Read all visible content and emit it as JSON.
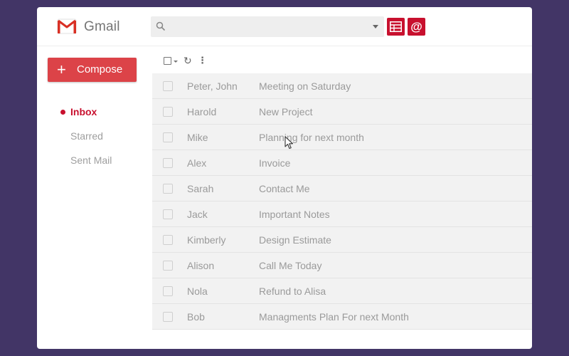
{
  "app": {
    "name": "Gmail"
  },
  "search": {
    "placeholder": "",
    "value": ""
  },
  "toolbar": {
    "sheet_icon": "spreadsheet-icon",
    "at_label": "@"
  },
  "sidebar": {
    "compose_label": "Compose",
    "items": [
      {
        "label": "Inbox",
        "active": true
      },
      {
        "label": "Starred",
        "active": false
      },
      {
        "label": "Sent Mail",
        "active": false
      }
    ]
  },
  "emails": [
    {
      "sender": "Peter, John",
      "subject": "Meeting on Saturday"
    },
    {
      "sender": "Harold",
      "subject": "New Project"
    },
    {
      "sender": "Mike",
      "subject": "Planning for next month"
    },
    {
      "sender": "Alex",
      "subject": "Invoice"
    },
    {
      "sender": "Sarah",
      "subject": "Contact Me"
    },
    {
      "sender": "Jack",
      "subject": "Important Notes"
    },
    {
      "sender": "Kimberly",
      "subject": "Design Estimate"
    },
    {
      "sender": "Alison",
      "subject": "Call Me Today"
    },
    {
      "sender": "Nola",
      "subject": "Refund to Alisa"
    },
    {
      "sender": "Bob",
      "subject": "Managments Plan For next Month"
    }
  ],
  "colors": {
    "background": "#423566",
    "accent": "#c8102e",
    "compose": "#dc4348"
  }
}
